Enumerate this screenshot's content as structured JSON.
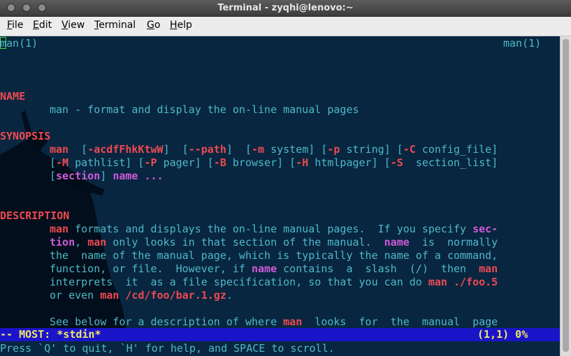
{
  "window": {
    "title": "Terminal - zyqhi@lenovo:~"
  },
  "menu": [
    {
      "acc": "F",
      "rest": "ile"
    },
    {
      "acc": "E",
      "rest": "dit"
    },
    {
      "acc": "V",
      "rest": "iew"
    },
    {
      "acc": "T",
      "rest": "erminal"
    },
    {
      "acc": "G",
      "rest": "o"
    },
    {
      "acc": "H",
      "rest": "elp"
    }
  ],
  "man": {
    "header_left": "man(1)",
    "header_right": "man(1)",
    "name_heading": "NAME",
    "name_text": "man - format and display the on-line manual pages",
    "synopsis_heading": "SYNOPSIS",
    "syn": {
      "cmd": "man",
      "opts1": "-acdfFhkKtwW",
      "path": "--path",
      "m": "-m",
      "system": "system",
      "p": "-p",
      "string": "string",
      "C": "-C",
      "config_file": "config_file",
      "M": "-M",
      "pathlist": "pathlist",
      "P": "-P",
      "pager": "pager",
      "B": "-B",
      "browser": "browser",
      "H": "-H",
      "htmlpager": "htmlpager",
      "S": "-S",
      "section_list": "section_list",
      "section": "section",
      "name": "name",
      "ellipsis": "..."
    },
    "description_heading": "DESCRIPTION",
    "desc": {
      "l1_man": "man",
      "l1_text": " formats and displays the on-line manual pages.  If you specify ",
      "l1_sec": "sec-",
      "l2_tion": "tion",
      "l2_a": ", ",
      "l2_man": "man",
      "l2_b": " only looks in that section of the manual.  ",
      "l2_name": "name",
      "l2_c": "  is  normally",
      "l3": "the  name of the manual page, which is typically the name of a command,",
      "l4_a": "function, or file.  However, if ",
      "l4_name": "name",
      "l4_b": " contains  a  slash  (/)  then  ",
      "l4_man": "man",
      "l5_a": "interprets  it  as a file specification, so that you can do ",
      "l5_cmd": "man ./foo.5",
      "l6_a": "or even ",
      "l6_cmd": "man /cd/foo/bar.1.gz",
      "l6_b": ".",
      "l8_a": "See below for a description of where ",
      "l8_man": "man",
      "l8_b": "  looks  for  the  manual  page"
    },
    "status_left": "-- MOST: *stdin*",
    "status_right": "(1,1) 0%",
    "prompt": "Press `Q' to quit, `H' for help, and SPACE to scroll."
  }
}
